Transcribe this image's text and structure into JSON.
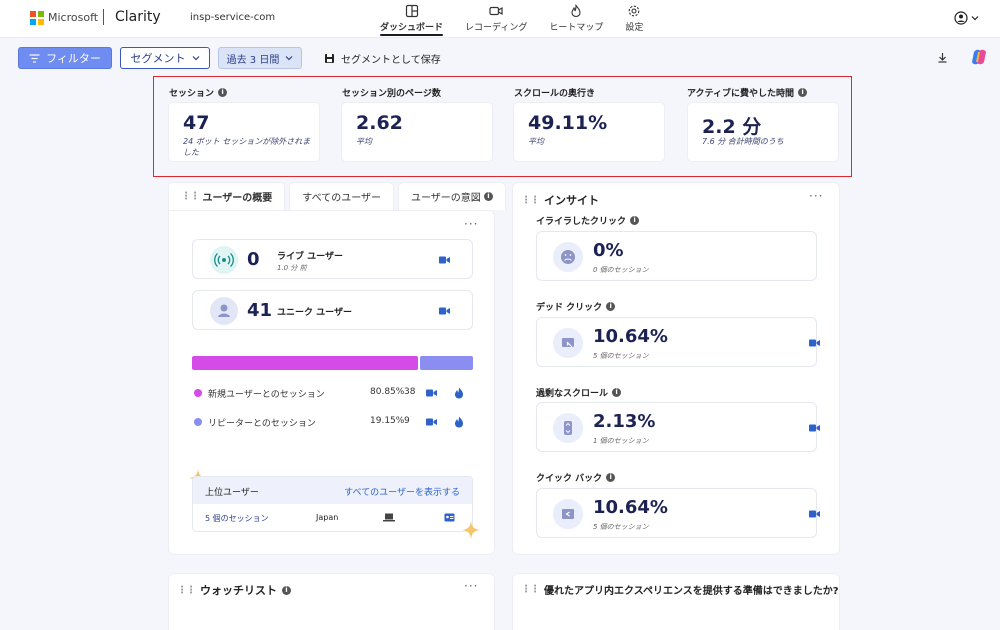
{
  "topbar": {
    "brand": "Microsoft",
    "product": "Clarity",
    "project": "insp-service-com",
    "nav": [
      {
        "label": "ダッシュボード",
        "icon": "dashboard-icon",
        "active": true
      },
      {
        "label": "レコーディング",
        "icon": "video-icon",
        "active": false
      },
      {
        "label": "ヒートマップ",
        "icon": "flame-icon",
        "active": false
      },
      {
        "label": "設定",
        "icon": "gear-icon",
        "active": false
      }
    ]
  },
  "toolbar": {
    "filter_label": "フィルター",
    "segment_label": "セグメント",
    "range_label": "過去 3 日間",
    "save_label": "セグメントとして保存"
  },
  "metrics": [
    {
      "label": "セッション",
      "value": "47",
      "sub": "24 ボット セッションが除外されました",
      "info": true
    },
    {
      "label": "セッション別のページ数",
      "value": "2.62",
      "sub": "平均",
      "info": false
    },
    {
      "label": "スクロールの奥行き",
      "value": "49.11%",
      "sub": "平均",
      "info": false
    },
    {
      "label": "アクティブに費やした時間",
      "value": "2.2 分",
      "sub": "7.6 分 合計時間のうち",
      "info": true
    }
  ],
  "users": {
    "tabs": [
      "ユーザーの概要",
      "すべてのユーザー",
      "ユーザーの意図"
    ],
    "live": {
      "value": "0",
      "label": "ライブ ユーザー",
      "sub": "1.0 分 前"
    },
    "unique": {
      "value": "41",
      "label": "ユニーク ユーザー"
    },
    "split": [
      {
        "label": "新規ユーザーとのセッション",
        "pct": "80.85%",
        "count": "38",
        "fraction": 0.8085,
        "color": "#d54be8"
      },
      {
        "label": "リピーターとのセッション",
        "pct": "19.15%",
        "count": "9",
        "fraction": 0.1915,
        "color": "#8b8ef0"
      }
    ],
    "top_users": {
      "title": "上位ユーザー",
      "link": "すべてのユーザーを表示する",
      "row": {
        "sessions": "5 個のセッション",
        "country": "Japan"
      }
    }
  },
  "insights": {
    "title": "インサイト",
    "items": [
      {
        "label": "イライラしたクリック",
        "value": "0%",
        "sub": "0 個のセッション",
        "icon": "frown-icon",
        "has_video": false
      },
      {
        "label": "デッド クリック",
        "value": "10.64%",
        "sub": "5 個のセッション",
        "icon": "dead-click-icon",
        "has_video": true
      },
      {
        "label": "過剰なスクロール",
        "value": "2.13%",
        "sub": "1 個のセッション",
        "icon": "scroll-icon",
        "has_video": true
      },
      {
        "label": "クイック バック",
        "value": "10.64%",
        "sub": "5 個のセッション",
        "icon": "quick-back-icon",
        "has_video": true
      }
    ]
  },
  "watchlist": {
    "title": "ウォッチリスト"
  },
  "readiness": {
    "title": "優れたアプリ内エクスペリエンスを提供する準備はできましたか?"
  }
}
